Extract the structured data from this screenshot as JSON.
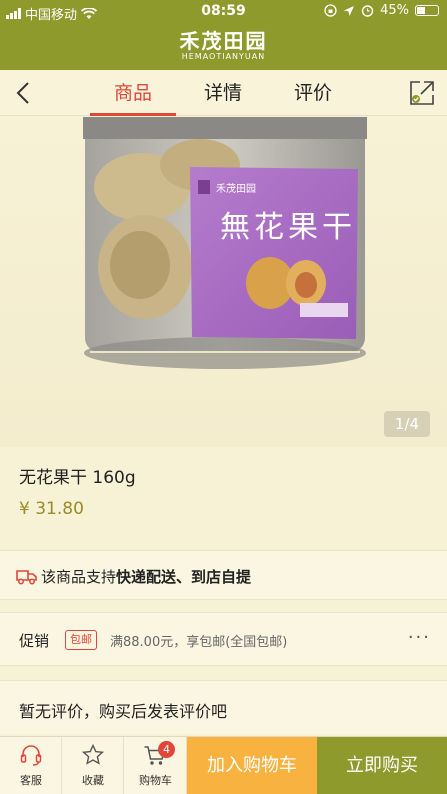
{
  "status_bar": {
    "carrier": "中国移动",
    "time": "08:59",
    "battery": "45%"
  },
  "brand": {
    "name": "禾茂田园",
    "name_en": "HEMAOTIANYUAN"
  },
  "nav": {
    "tabs": [
      {
        "label": "商品",
        "active": true
      },
      {
        "label": "详情",
        "active": false
      },
      {
        "label": "评价",
        "active": false
      }
    ]
  },
  "gallery": {
    "counter": "1/4",
    "label_text": "無花果干",
    "label_small": "禾茂田园"
  },
  "product": {
    "title": "无花果干  160g",
    "price": "¥ 31.80"
  },
  "delivery": {
    "prefix": "该商品支持",
    "methods": "快递配送、到店自提"
  },
  "promo": {
    "label": "促销",
    "badge": "包邮",
    "desc": "满88.00元，享包邮(全国包邮)",
    "more": "···"
  },
  "review": {
    "text": "暂无评价，购买后发表评价吧"
  },
  "bottom": {
    "service": "客服",
    "favorite": "收藏",
    "cart": "购物车",
    "cart_count": "4",
    "add_to_cart": "加入购物车",
    "buy_now": "立即购买"
  },
  "colors": {
    "brand": "#8e9a2b",
    "accent": "#e0463a",
    "price": "#9a8b2a",
    "add_to_cart": "#f7b240"
  }
}
